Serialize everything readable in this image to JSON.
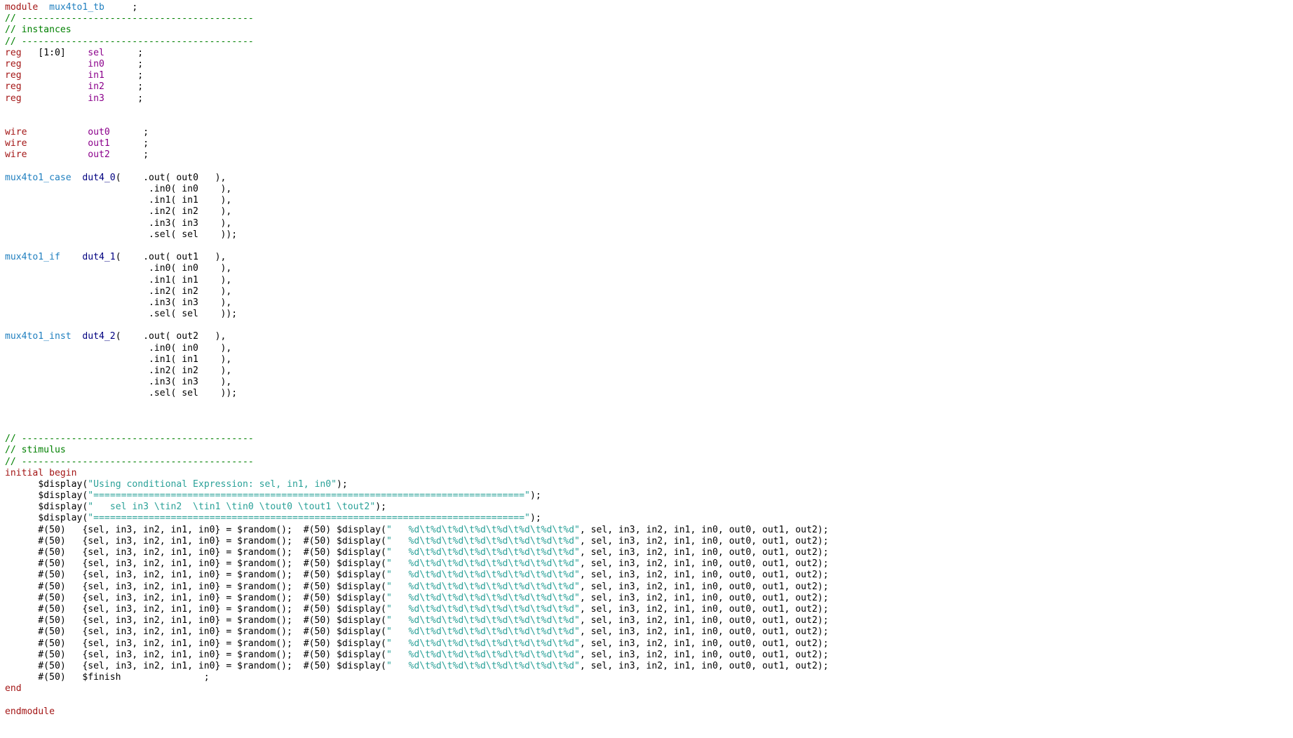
{
  "editor": {
    "language": "verilog",
    "colors": {
      "background": "#ffffff",
      "keyword": "#a31515",
      "identifier": "#8b008b",
      "module_name": "#1f7fbf",
      "instance_name": "#000080",
      "comment": "#008000",
      "string": "#2aa198",
      "text": "#000000"
    },
    "lines": [
      [
        {
          "t": "kw",
          "s": "module"
        },
        {
          "t": "txt",
          "s": "  "
        },
        {
          "t": "mod",
          "s": "mux4to1_tb"
        },
        {
          "t": "txt",
          "s": "     ;"
        }
      ],
      [
        {
          "t": "cmt",
          "s": "// ------------------------------------------"
        }
      ],
      [
        {
          "t": "cmt",
          "s": "// instances"
        }
      ],
      [
        {
          "t": "cmt",
          "s": "// ------------------------------------------"
        }
      ],
      [
        {
          "t": "kw",
          "s": "reg"
        },
        {
          "t": "txt",
          "s": "   [1:0]    "
        },
        {
          "t": "id",
          "s": "sel"
        },
        {
          "t": "txt",
          "s": "      ;"
        }
      ],
      [
        {
          "t": "kw",
          "s": "reg"
        },
        {
          "t": "txt",
          "s": "            "
        },
        {
          "t": "id",
          "s": "in0"
        },
        {
          "t": "txt",
          "s": "      ;"
        }
      ],
      [
        {
          "t": "kw",
          "s": "reg"
        },
        {
          "t": "txt",
          "s": "            "
        },
        {
          "t": "id",
          "s": "in1"
        },
        {
          "t": "txt",
          "s": "      ;"
        }
      ],
      [
        {
          "t": "kw",
          "s": "reg"
        },
        {
          "t": "txt",
          "s": "            "
        },
        {
          "t": "id",
          "s": "in2"
        },
        {
          "t": "txt",
          "s": "      ;"
        }
      ],
      [
        {
          "t": "kw",
          "s": "reg"
        },
        {
          "t": "txt",
          "s": "            "
        },
        {
          "t": "id",
          "s": "in3"
        },
        {
          "t": "txt",
          "s": "      ;"
        }
      ],
      [],
      [],
      [
        {
          "t": "kw",
          "s": "wire"
        },
        {
          "t": "txt",
          "s": "           "
        },
        {
          "t": "id",
          "s": "out0"
        },
        {
          "t": "txt",
          "s": "      ;"
        }
      ],
      [
        {
          "t": "kw",
          "s": "wire"
        },
        {
          "t": "txt",
          "s": "           "
        },
        {
          "t": "id",
          "s": "out1"
        },
        {
          "t": "txt",
          "s": "      ;"
        }
      ],
      [
        {
          "t": "kw",
          "s": "wire"
        },
        {
          "t": "txt",
          "s": "           "
        },
        {
          "t": "id",
          "s": "out2"
        },
        {
          "t": "txt",
          "s": "      ;"
        }
      ],
      [],
      [
        {
          "t": "mod",
          "s": "mux4to1_case"
        },
        {
          "t": "txt",
          "s": "  "
        },
        {
          "t": "inst",
          "s": "dut4_0"
        },
        {
          "t": "txt",
          "s": "(    .out( out0   ),"
        }
      ],
      [
        {
          "t": "txt",
          "s": "                          .in0( in0    ),"
        }
      ],
      [
        {
          "t": "txt",
          "s": "                          .in1( in1    ),"
        }
      ],
      [
        {
          "t": "txt",
          "s": "                          .in2( in2    ),"
        }
      ],
      [
        {
          "t": "txt",
          "s": "                          .in3( in3    ),"
        }
      ],
      [
        {
          "t": "txt",
          "s": "                          .sel( sel    ));"
        }
      ],
      [],
      [
        {
          "t": "mod",
          "s": "mux4to1_if"
        },
        {
          "t": "txt",
          "s": "    "
        },
        {
          "t": "inst",
          "s": "dut4_1"
        },
        {
          "t": "txt",
          "s": "(    .out( out1   ),"
        }
      ],
      [
        {
          "t": "txt",
          "s": "                          .in0( in0    ),"
        }
      ],
      [
        {
          "t": "txt",
          "s": "                          .in1( in1    ),"
        }
      ],
      [
        {
          "t": "txt",
          "s": "                          .in2( in2    ),"
        }
      ],
      [
        {
          "t": "txt",
          "s": "                          .in3( in3    ),"
        }
      ],
      [
        {
          "t": "txt",
          "s": "                          .sel( sel    ));"
        }
      ],
      [],
      [
        {
          "t": "mod",
          "s": "mux4to1_inst"
        },
        {
          "t": "txt",
          "s": "  "
        },
        {
          "t": "inst",
          "s": "dut4_2"
        },
        {
          "t": "txt",
          "s": "(    .out( out2   ),"
        }
      ],
      [
        {
          "t": "txt",
          "s": "                          .in0( in0    ),"
        }
      ],
      [
        {
          "t": "txt",
          "s": "                          .in1( in1    ),"
        }
      ],
      [
        {
          "t": "txt",
          "s": "                          .in2( in2    ),"
        }
      ],
      [
        {
          "t": "txt",
          "s": "                          .in3( in3    ),"
        }
      ],
      [
        {
          "t": "txt",
          "s": "                          .sel( sel    ));"
        }
      ],
      [],
      [],
      [],
      [
        {
          "t": "cmt",
          "s": "// ------------------------------------------"
        }
      ],
      [
        {
          "t": "cmt",
          "s": "// stimulus"
        }
      ],
      [
        {
          "t": "cmt",
          "s": "// ------------------------------------------"
        }
      ],
      [
        {
          "t": "kw",
          "s": "initial begin"
        }
      ],
      [
        {
          "t": "txt",
          "s": "      "
        },
        {
          "t": "sys",
          "s": "$display"
        },
        {
          "t": "txt",
          "s": "("
        },
        {
          "t": "str",
          "s": "\"Using conditional Expression: sel, in1, in0\""
        },
        {
          "t": "txt",
          "s": ");"
        }
      ],
      [
        {
          "t": "txt",
          "s": "      "
        },
        {
          "t": "sys",
          "s": "$display"
        },
        {
          "t": "txt",
          "s": "("
        },
        {
          "t": "str",
          "s": "\"==============================================================================\""
        },
        {
          "t": "txt",
          "s": ");"
        }
      ],
      [
        {
          "t": "txt",
          "s": "      "
        },
        {
          "t": "sys",
          "s": "$display"
        },
        {
          "t": "txt",
          "s": "("
        },
        {
          "t": "str",
          "s": "\"   sel in3 \\tin2  \\tin1 \\tin0 \\tout0 \\tout1 \\tout2\""
        },
        {
          "t": "txt",
          "s": ");"
        }
      ],
      [
        {
          "t": "txt",
          "s": "      "
        },
        {
          "t": "sys",
          "s": "$display"
        },
        {
          "t": "txt",
          "s": "("
        },
        {
          "t": "str",
          "s": "\"==============================================================================\""
        },
        {
          "t": "txt",
          "s": ");"
        }
      ],
      [
        {
          "t": "txt",
          "s": "      #(50)   {sel, in3, in2, in1, in0} = $random();  #(50) $display("
        },
        {
          "t": "str",
          "s": "\"   %d\\t%d\\t%d\\t%d\\t%d\\t%d\\t%d\\t%d\""
        },
        {
          "t": "txt",
          "s": ", sel, in3, in2, in1, in0, out0, out1, out2);"
        }
      ],
      [
        {
          "t": "txt",
          "s": "      #(50)   {sel, in3, in2, in1, in0} = $random();  #(50) $display("
        },
        {
          "t": "str",
          "s": "\"   %d\\t%d\\t%d\\t%d\\t%d\\t%d\\t%d\\t%d\""
        },
        {
          "t": "txt",
          "s": ", sel, in3, in2, in1, in0, out0, out1, out2);"
        }
      ],
      [
        {
          "t": "txt",
          "s": "      #(50)   {sel, in3, in2, in1, in0} = $random();  #(50) $display("
        },
        {
          "t": "str",
          "s": "\"   %d\\t%d\\t%d\\t%d\\t%d\\t%d\\t%d\\t%d\""
        },
        {
          "t": "txt",
          "s": ", sel, in3, in2, in1, in0, out0, out1, out2);"
        }
      ],
      [
        {
          "t": "txt",
          "s": "      #(50)   {sel, in3, in2, in1, in0} = $random();  #(50) $display("
        },
        {
          "t": "str",
          "s": "\"   %d\\t%d\\t%d\\t%d\\t%d\\t%d\\t%d\\t%d\""
        },
        {
          "t": "txt",
          "s": ", sel, in3, in2, in1, in0, out0, out1, out2);"
        }
      ],
      [
        {
          "t": "txt",
          "s": "      #(50)   {sel, in3, in2, in1, in0} = $random();  #(50) $display("
        },
        {
          "t": "str",
          "s": "\"   %d\\t%d\\t%d\\t%d\\t%d\\t%d\\t%d\\t%d\""
        },
        {
          "t": "txt",
          "s": ", sel, in3, in2, in1, in0, out0, out1, out2);"
        }
      ],
      [
        {
          "t": "txt",
          "s": "      #(50)   {sel, in3, in2, in1, in0} = $random();  #(50) $display("
        },
        {
          "t": "str",
          "s": "\"   %d\\t%d\\t%d\\t%d\\t%d\\t%d\\t%d\\t%d\""
        },
        {
          "t": "txt",
          "s": ", sel, in3, in2, in1, in0, out0, out1, out2);"
        }
      ],
      [
        {
          "t": "txt",
          "s": "      #(50)   {sel, in3, in2, in1, in0} = $random();  #(50) $display("
        },
        {
          "t": "str",
          "s": "\"   %d\\t%d\\t%d\\t%d\\t%d\\t%d\\t%d\\t%d\""
        },
        {
          "t": "txt",
          "s": ", sel, in3, in2, in1, in0, out0, out1, out2);"
        }
      ],
      [
        {
          "t": "txt",
          "s": "      #(50)   {sel, in3, in2, in1, in0} = $random();  #(50) $display("
        },
        {
          "t": "str",
          "s": "\"   %d\\t%d\\t%d\\t%d\\t%d\\t%d\\t%d\\t%d\""
        },
        {
          "t": "txt",
          "s": ", sel, in3, in2, in1, in0, out0, out1, out2);"
        }
      ],
      [
        {
          "t": "txt",
          "s": "      #(50)   {sel, in3, in2, in1, in0} = $random();  #(50) $display("
        },
        {
          "t": "str",
          "s": "\"   %d\\t%d\\t%d\\t%d\\t%d\\t%d\\t%d\\t%d\""
        },
        {
          "t": "txt",
          "s": ", sel, in3, in2, in1, in0, out0, out1, out2);"
        }
      ],
      [
        {
          "t": "txt",
          "s": "      #(50)   {sel, in3, in2, in1, in0} = $random();  #(50) $display("
        },
        {
          "t": "str",
          "s": "\"   %d\\t%d\\t%d\\t%d\\t%d\\t%d\\t%d\\t%d\""
        },
        {
          "t": "txt",
          "s": ", sel, in3, in2, in1, in0, out0, out1, out2);"
        }
      ],
      [
        {
          "t": "txt",
          "s": "      #(50)   {sel, in3, in2, in1, in0} = $random();  #(50) $display("
        },
        {
          "t": "str",
          "s": "\"   %d\\t%d\\t%d\\t%d\\t%d\\t%d\\t%d\\t%d\""
        },
        {
          "t": "txt",
          "s": ", sel, in3, in2, in1, in0, out0, out1, out2);"
        }
      ],
      [
        {
          "t": "txt",
          "s": "      #(50)   {sel, in3, in2, in1, in0} = $random();  #(50) $display("
        },
        {
          "t": "str",
          "s": "\"   %d\\t%d\\t%d\\t%d\\t%d\\t%d\\t%d\\t%d\""
        },
        {
          "t": "txt",
          "s": ", sel, in3, in2, in1, in0, out0, out1, out2);"
        }
      ],
      [
        {
          "t": "txt",
          "s": "      #(50)   {sel, in3, in2, in1, in0} = $random();  #(50) $display("
        },
        {
          "t": "str",
          "s": "\"   %d\\t%d\\t%d\\t%d\\t%d\\t%d\\t%d\\t%d\""
        },
        {
          "t": "txt",
          "s": ", sel, in3, in2, in1, in0, out0, out1, out2);"
        }
      ],
      [
        {
          "t": "txt",
          "s": "      #(50)   $finish               ;"
        }
      ],
      [
        {
          "t": "kw",
          "s": "end"
        }
      ],
      [],
      [
        {
          "t": "kw",
          "s": "endmodule"
        }
      ]
    ]
  }
}
